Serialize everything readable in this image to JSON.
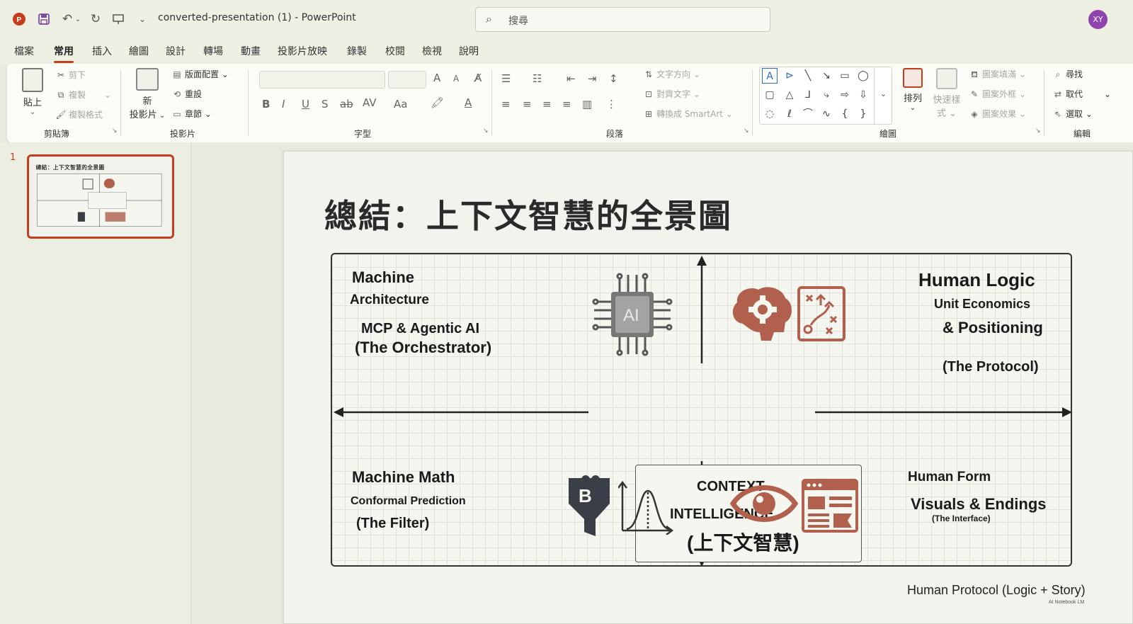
{
  "app": {
    "title": "converted-presentation (1)  -  PowerPoint",
    "search_placeholder": "搜尋",
    "user_initials": "XY"
  },
  "menu_tabs": [
    {
      "label": "檔案"
    },
    {
      "label": "常用"
    },
    {
      "label": "插入"
    },
    {
      "label": "繪圖"
    },
    {
      "label": "設計"
    },
    {
      "label": "轉場"
    },
    {
      "label": "動畫"
    },
    {
      "label": "投影片放映"
    },
    {
      "label": "錄製"
    },
    {
      "label": "校閱"
    },
    {
      "label": "檢視"
    },
    {
      "label": "說明"
    }
  ],
  "ribbon": {
    "clipboard": {
      "paste": "貼上",
      "cut": "剪下",
      "copy": "複製",
      "format_painter": "複製格式",
      "group": "剪貼簿"
    },
    "slides": {
      "new_slide_1": "新",
      "new_slide_2": "投影片",
      "layout": "版面配置",
      "reset": "重設",
      "section": "章節",
      "group": "投影片"
    },
    "font": {
      "group": "字型",
      "bold": "B",
      "italic": "I",
      "underline": "U",
      "shadow": "S",
      "strike": "ab",
      "spacing": "AV",
      "case": "Aa",
      "grow": "A",
      "shrink": "A",
      "color": "A"
    },
    "paragraph": {
      "group": "段落",
      "text_direction": "文字方向",
      "align_text": "對齊文字",
      "smartart": "轉換成 SmartArt"
    },
    "drawing": {
      "group": "繪圖",
      "arrange": "排列",
      "quick_styles_1": "快速樣",
      "quick_styles_2": "式",
      "shape_fill": "圖案填滿",
      "shape_outline": "圖案外框",
      "shape_effects": "圖案效果"
    },
    "editing": {
      "group": "編輯",
      "find": "尋找",
      "replace": "取代",
      "select": "選取"
    }
  },
  "thumbnail": {
    "number": "1"
  },
  "slide": {
    "title": "總結：上下文智慧的全景圖",
    "tl": {
      "l1": "Machine",
      "l2": "Architecture",
      "l3": "MCP & Agentic AI",
      "l4": "(The Orchestrator)"
    },
    "tr": {
      "l1": "Human Logic",
      "l2": "Unit Economics",
      "l3": "& Positioning",
      "l4": "(The Protocol)"
    },
    "bl": {
      "l1": "Machine Math",
      "l2": "Conformal Prediction",
      "l3": "(The Filter)"
    },
    "br": {
      "l1": "Human Form",
      "l2": "Visuals & Endings",
      "l3": "(The Interface)"
    },
    "center": {
      "l1": "CONTEXT",
      "l2": "INTELLIGENCE",
      "l3": "(上下文智慧)"
    },
    "chip_label": "AI",
    "funnel_label": "B",
    "footer": "Human Protocol (Logic + Story)",
    "footer_small": "AI Notebook LM"
  },
  "colors": {
    "accent": "#c43e1c",
    "icon_brown": "#b0604c",
    "icon_dark": "#3a3f47"
  }
}
